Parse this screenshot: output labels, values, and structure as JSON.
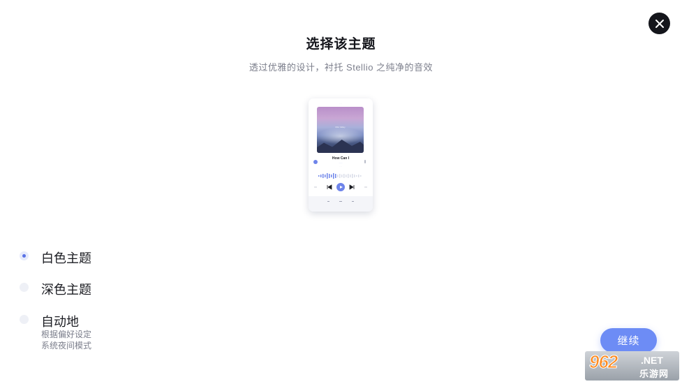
{
  "header": {
    "title": "选择该主题",
    "subtitle": "透过优雅的设计，衬托 Stellio 之纯净的音效"
  },
  "preview": {
    "song_title": "How Can I",
    "art_caption": "Mist Valley"
  },
  "options": [
    {
      "label": "白色主题",
      "selected": true
    },
    {
      "label": "深色主题",
      "selected": false
    },
    {
      "label": "自动地",
      "desc_line1": "根据偏好设定",
      "desc_line2": "系统夜间模式",
      "selected": false
    }
  ],
  "actions": {
    "continue_label": "继续"
  },
  "watermark": {
    "number": "962",
    "net": ".NET",
    "site": "乐游网"
  },
  "colors": {
    "accent": "#6d8cf5",
    "radio_selected": "#5a72e6",
    "text_primary": "#1b1c22",
    "text_secondary": "#7c7f8c",
    "close_bg": "#14151b"
  },
  "icons": {
    "close": "close-icon",
    "play": "play-icon",
    "prev": "previous-icon",
    "next": "next-icon"
  }
}
